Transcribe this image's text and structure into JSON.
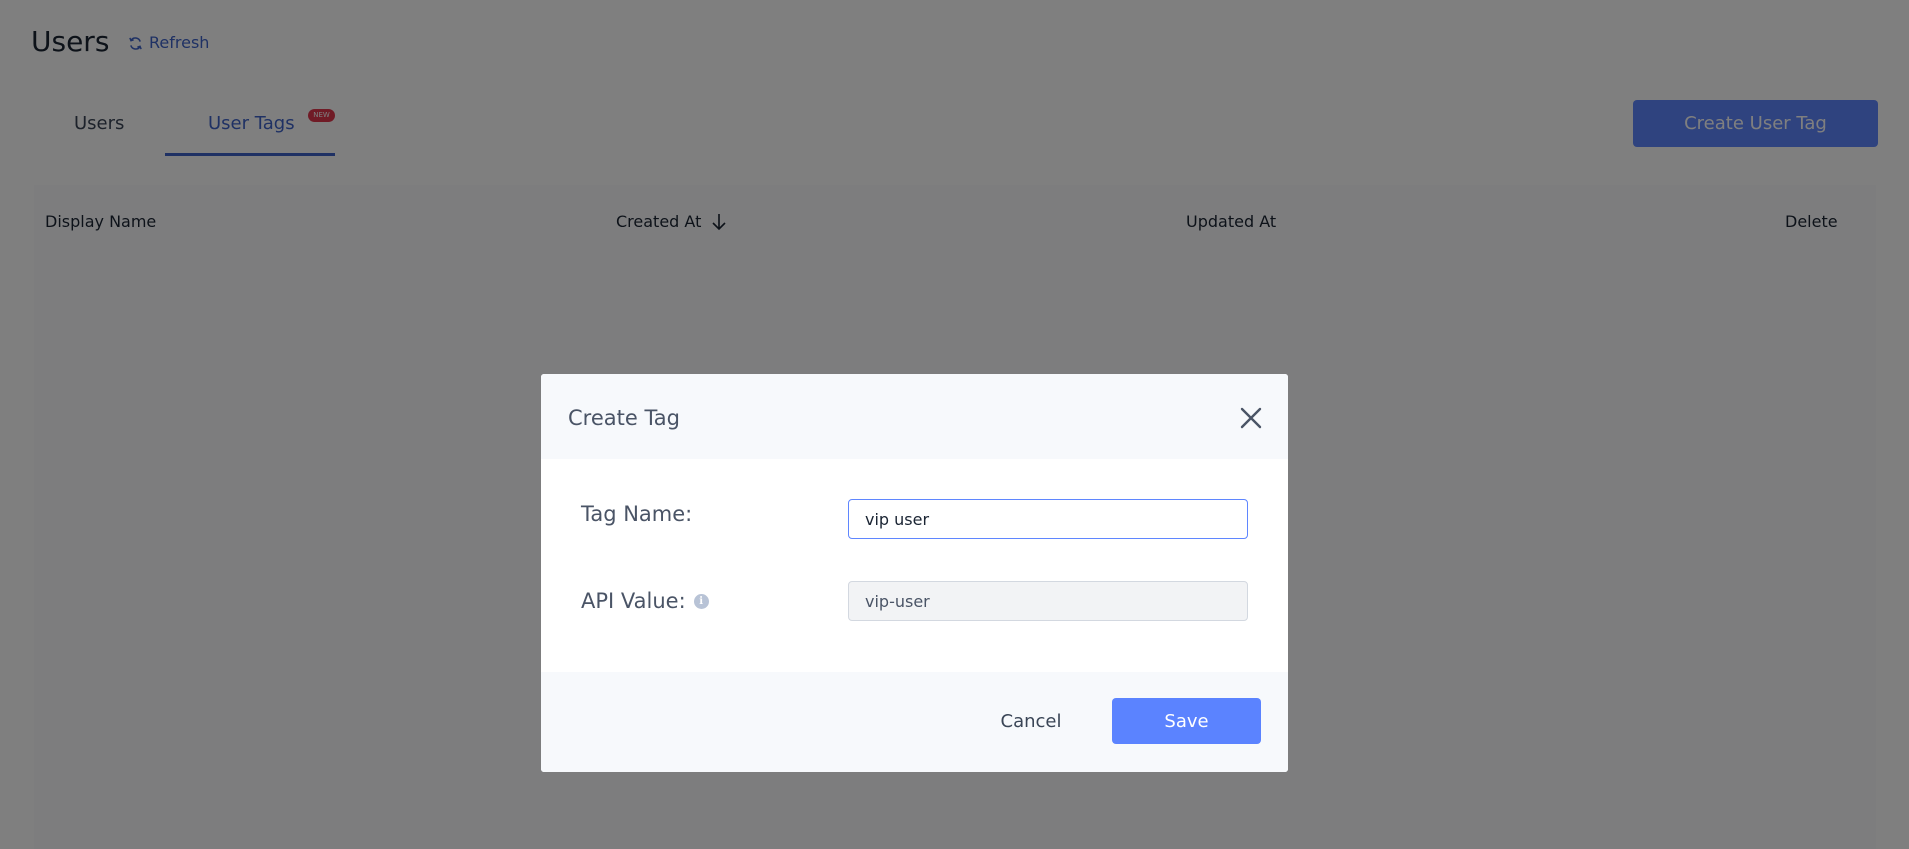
{
  "header": {
    "title": "Users",
    "refresh_label": "Refresh",
    "refresh_icon": "refresh-icon"
  },
  "tabs": [
    {
      "label": "Users",
      "active": false
    },
    {
      "label": "User Tags",
      "active": true,
      "badge": "NEW"
    }
  ],
  "toolbar": {
    "create_user_tag_label": "Create User Tag"
  },
  "table": {
    "columns": [
      "Display Name",
      "Created At",
      "Updated At",
      "Delete"
    ],
    "sort_icon": "arrow-down-icon",
    "rows": []
  },
  "modal": {
    "title": "Create Tag",
    "close_icon": "close-icon",
    "fields": {
      "tag_name": {
        "label": "Tag Name:",
        "value": "vip user"
      },
      "api_value": {
        "label": "API Value:",
        "value": "vip-user",
        "info_icon": "info-icon"
      }
    },
    "cancel_label": "Cancel",
    "save_label": "Save"
  },
  "colors": {
    "accent": "#5b83ff",
    "link": "#3e63c9",
    "badge": "#e0364d",
    "overlay": "rgba(0,0,0,0.5)"
  }
}
